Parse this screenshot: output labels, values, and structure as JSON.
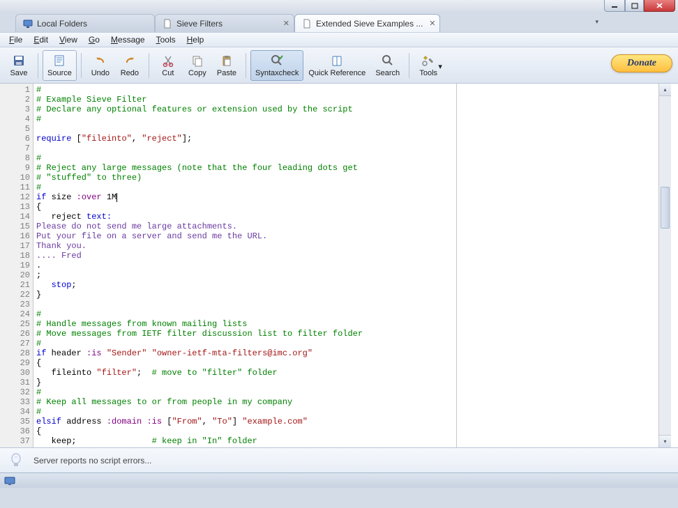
{
  "tabs": [
    {
      "label": "Local Folders",
      "closable": false
    },
    {
      "label": "Sieve Filters",
      "closable": true
    },
    {
      "label": "Extended Sieve Examples ...",
      "closable": true
    }
  ],
  "active_tab": 2,
  "menu": {
    "file": "File",
    "edit": "Edit",
    "view": "View",
    "go": "Go",
    "message": "Message",
    "tools": "Tools",
    "help": "Help"
  },
  "toolbar": {
    "save": "Save",
    "source": "Source",
    "undo": "Undo",
    "redo": "Redo",
    "cut": "Cut",
    "copy": "Copy",
    "paste": "Paste",
    "syntaxcheck": "Syntaxcheck",
    "quickref": "Quick Reference",
    "search": "Search",
    "tools": "Tools",
    "donate": "Donate"
  },
  "code": {
    "lines": [
      {
        "n": 1,
        "t": [
          {
            "c": "cm",
            "s": "#"
          }
        ]
      },
      {
        "n": 2,
        "t": [
          {
            "c": "cm",
            "s": "# Example Sieve Filter"
          }
        ]
      },
      {
        "n": 3,
        "t": [
          {
            "c": "cm",
            "s": "# Declare any optional features or extension used by the script"
          }
        ]
      },
      {
        "n": 4,
        "t": [
          {
            "c": "cm",
            "s": "#"
          }
        ]
      },
      {
        "n": 5,
        "t": []
      },
      {
        "n": 6,
        "t": [
          {
            "c": "kw",
            "s": "require"
          },
          {
            "c": "",
            "s": " ["
          },
          {
            "c": "str",
            "s": "\"fileinto\""
          },
          {
            "c": "",
            "s": ", "
          },
          {
            "c": "str",
            "s": "\"reject\""
          },
          {
            "c": "",
            "s": "];"
          }
        ]
      },
      {
        "n": 7,
        "t": []
      },
      {
        "n": 8,
        "t": [
          {
            "c": "cm",
            "s": "#"
          }
        ]
      },
      {
        "n": 9,
        "t": [
          {
            "c": "cm",
            "s": "# Reject any large messages (note that the four leading dots get"
          }
        ]
      },
      {
        "n": 10,
        "t": [
          {
            "c": "cm",
            "s": "# \"stuffed\" to three)"
          }
        ]
      },
      {
        "n": 11,
        "t": [
          {
            "c": "cm",
            "s": "#"
          }
        ]
      },
      {
        "n": 12,
        "t": [
          {
            "c": "kw",
            "s": "if"
          },
          {
            "c": "",
            "s": " size "
          },
          {
            "c": "tag",
            "s": ":over"
          },
          {
            "c": "",
            "s": " 1M"
          }
        ]
      },
      {
        "n": 13,
        "t": [
          {
            "c": "",
            "s": "{"
          }
        ]
      },
      {
        "n": 14,
        "t": [
          {
            "c": "",
            "s": "   reject "
          },
          {
            "c": "kw",
            "s": "text:"
          }
        ]
      },
      {
        "n": 15,
        "t": [
          {
            "c": "txt",
            "s": "Please do not send me large attachments."
          }
        ]
      },
      {
        "n": 16,
        "t": [
          {
            "c": "txt",
            "s": "Put your file on a server and send me the URL."
          }
        ]
      },
      {
        "n": 17,
        "t": [
          {
            "c": "txt",
            "s": "Thank you."
          }
        ]
      },
      {
        "n": 18,
        "t": [
          {
            "c": "txt",
            "s": ".... Fred"
          }
        ]
      },
      {
        "n": 19,
        "t": [
          {
            "c": "",
            "s": "."
          }
        ]
      },
      {
        "n": 20,
        "t": [
          {
            "c": "",
            "s": ";"
          }
        ]
      },
      {
        "n": 21,
        "t": [
          {
            "c": "",
            "s": "   "
          },
          {
            "c": "kw",
            "s": "stop"
          },
          {
            "c": "",
            "s": ";"
          }
        ]
      },
      {
        "n": 22,
        "t": [
          {
            "c": "",
            "s": "}"
          }
        ]
      },
      {
        "n": 23,
        "t": []
      },
      {
        "n": 24,
        "t": [
          {
            "c": "cm",
            "s": "#"
          }
        ]
      },
      {
        "n": 25,
        "t": [
          {
            "c": "cm",
            "s": "# Handle messages from known mailing lists"
          }
        ]
      },
      {
        "n": 26,
        "t": [
          {
            "c": "cm",
            "s": "# Move messages from IETF filter discussion list to filter folder"
          }
        ]
      },
      {
        "n": 27,
        "t": [
          {
            "c": "cm",
            "s": "#"
          }
        ]
      },
      {
        "n": 28,
        "t": [
          {
            "c": "kw",
            "s": "if"
          },
          {
            "c": "",
            "s": " header "
          },
          {
            "c": "tag",
            "s": ":is"
          },
          {
            "c": "",
            "s": " "
          },
          {
            "c": "str",
            "s": "\"Sender\""
          },
          {
            "c": "",
            "s": " "
          },
          {
            "c": "str",
            "s": "\"owner-ietf-mta-filters@imc.org\""
          }
        ]
      },
      {
        "n": 29,
        "t": [
          {
            "c": "",
            "s": "{"
          }
        ]
      },
      {
        "n": 30,
        "t": [
          {
            "c": "",
            "s": "   fileinto "
          },
          {
            "c": "str",
            "s": "\"filter\""
          },
          {
            "c": "",
            "s": ";  "
          },
          {
            "c": "cm",
            "s": "# move to \"filter\" folder"
          }
        ]
      },
      {
        "n": 31,
        "t": [
          {
            "c": "",
            "s": "}"
          }
        ]
      },
      {
        "n": 32,
        "t": [
          {
            "c": "cm",
            "s": "#"
          }
        ]
      },
      {
        "n": 33,
        "t": [
          {
            "c": "cm",
            "s": "# Keep all messages to or from people in my company"
          }
        ]
      },
      {
        "n": 34,
        "t": [
          {
            "c": "cm",
            "s": "#"
          }
        ]
      },
      {
        "n": 35,
        "t": [
          {
            "c": "kw",
            "s": "elsif"
          },
          {
            "c": "",
            "s": " address "
          },
          {
            "c": "tag",
            "s": ":domain"
          },
          {
            "c": "",
            "s": " "
          },
          {
            "c": "tag",
            "s": ":is"
          },
          {
            "c": "",
            "s": " ["
          },
          {
            "c": "str",
            "s": "\"From\""
          },
          {
            "c": "",
            "s": ", "
          },
          {
            "c": "str",
            "s": "\"To\""
          },
          {
            "c": "",
            "s": "] "
          },
          {
            "c": "str",
            "s": "\"example.com\""
          }
        ]
      },
      {
        "n": 36,
        "t": [
          {
            "c": "",
            "s": "{"
          }
        ]
      },
      {
        "n": 37,
        "t": [
          {
            "c": "",
            "s": "   keep;               "
          },
          {
            "c": "cm",
            "s": "# keep in \"In\" folder"
          }
        ]
      }
    ]
  },
  "status": {
    "message": "Server reports no script errors..."
  }
}
